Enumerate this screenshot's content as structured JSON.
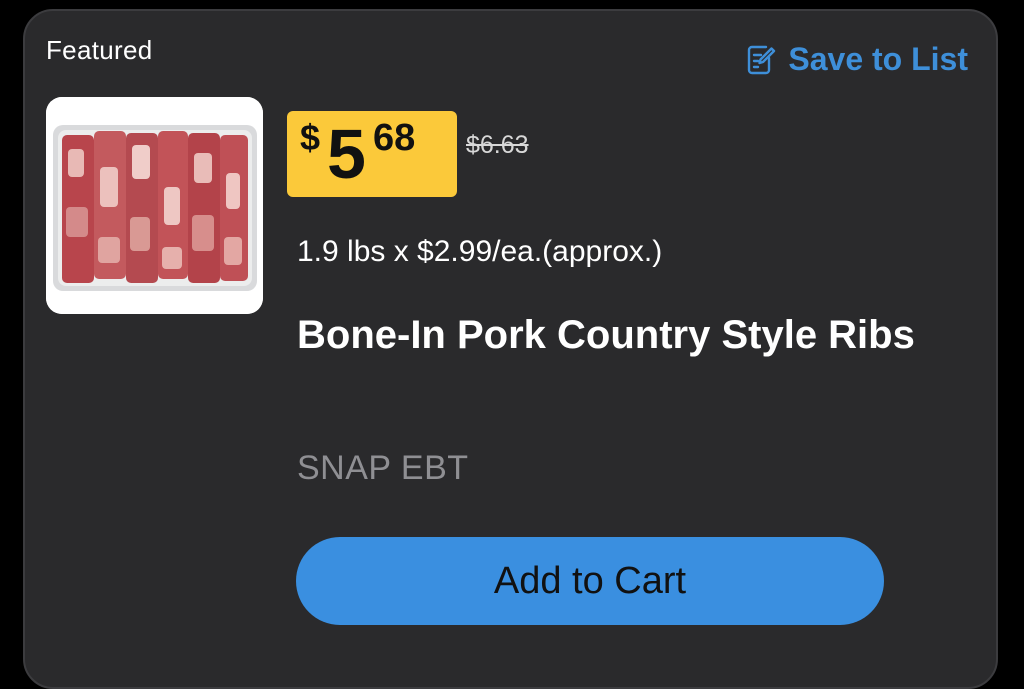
{
  "card": {
    "badge": "Featured",
    "save_to_list": {
      "label": "Save to List",
      "icon": "edit-list-icon"
    },
    "product": {
      "image_alt": "Bone-In Pork Country Style Ribs in tray",
      "price": {
        "currency_symbol": "$",
        "dollars": "5",
        "cents": "68"
      },
      "original_price": "$6.63",
      "quantity_text": "1.9 lbs x $2.99/ea.(approx.)",
      "name": "Bone-In Pork Country Style Ribs",
      "snap_label": "SNAP EBT"
    },
    "add_to_cart_label": "Add to Cart"
  },
  "colors": {
    "background": "#000000",
    "card": "#2a2a2c",
    "accent": "#3e8fd9",
    "price_tag": "#fbc93a",
    "button": "#3a8fe0",
    "muted_text": "#8f8f93"
  }
}
